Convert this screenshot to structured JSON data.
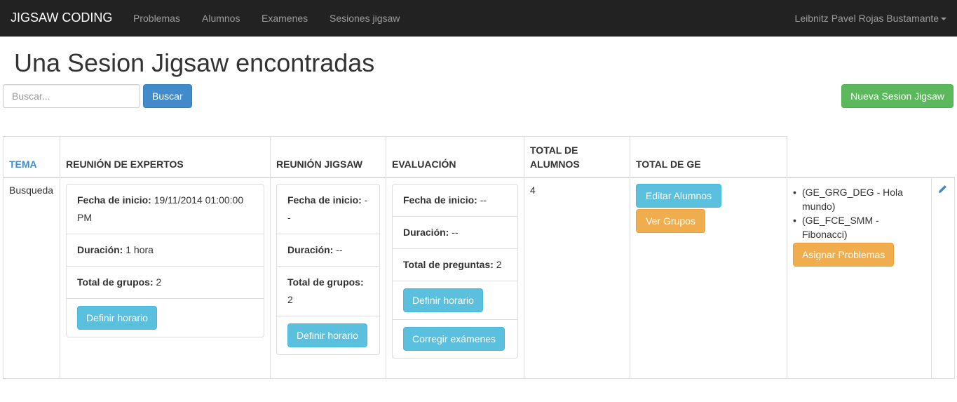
{
  "navbar": {
    "brand": "JIGSAW CODING",
    "links": [
      "Problemas",
      "Alumnos",
      "Examenes",
      "Sesiones jigsaw"
    ],
    "user": "Leibnitz Pavel Rojas Bustamante"
  },
  "page_title": "Una Sesion Jigsaw encontradas",
  "search": {
    "placeholder": "Buscar...",
    "button": "Buscar"
  },
  "new_button": "Nueva Sesion Jigsaw",
  "table": {
    "headers": {
      "tema": "TEMA",
      "expertos": "REUNIÓN DE EXPERTOS",
      "jigsaw": "REUNIÓN JIGSAW",
      "evaluacion": "EVALUACIÓN",
      "alumnos": "TOTAL DE ALUMNOS",
      "ge": "TOTAL DE GE"
    },
    "row": {
      "tema": "Busqueda",
      "expertos": {
        "fecha_label": "Fecha de inicio:",
        "fecha_value": "19/11/2014 01:00:00 PM",
        "duracion_label": "Duración:",
        "duracion_value": "1 hora",
        "grupos_label": "Total de grupos:",
        "grupos_value": "2",
        "button": "Definir horario"
      },
      "jigsaw": {
        "fecha_label": "Fecha de inicio:",
        "fecha_value": "--",
        "duracion_label": "Duración:",
        "duracion_value": "--",
        "grupos_label": "Total de grupos:",
        "grupos_value": "2",
        "button": "Definir horario"
      },
      "evaluacion": {
        "fecha_label": "Fecha de inicio:",
        "fecha_value": "--",
        "duracion_label": "Duración:",
        "duracion_value": "--",
        "preguntas_label": "Total de preguntas:",
        "preguntas_value": "2",
        "button_horario": "Definir horario",
        "button_corregir": "Corregir exámenes"
      },
      "total_alumnos": "4",
      "alumnos_buttons": {
        "editar": "Editar Alumnos",
        "grupos": "Ver Grupos"
      },
      "ge_items": [
        "(GE_GRG_DEG - Hola mundo)",
        "(GE_FCE_SMM - Fibonacci)"
      ],
      "asignar_button": "Asignar Problemas",
      "edit_icon": "pencil-icon"
    }
  },
  "colors": {
    "navbar_bg": "#222222",
    "primary": "#428bca",
    "success": "#5cb85c",
    "info": "#5bc0de",
    "warning": "#f0ad4e"
  }
}
